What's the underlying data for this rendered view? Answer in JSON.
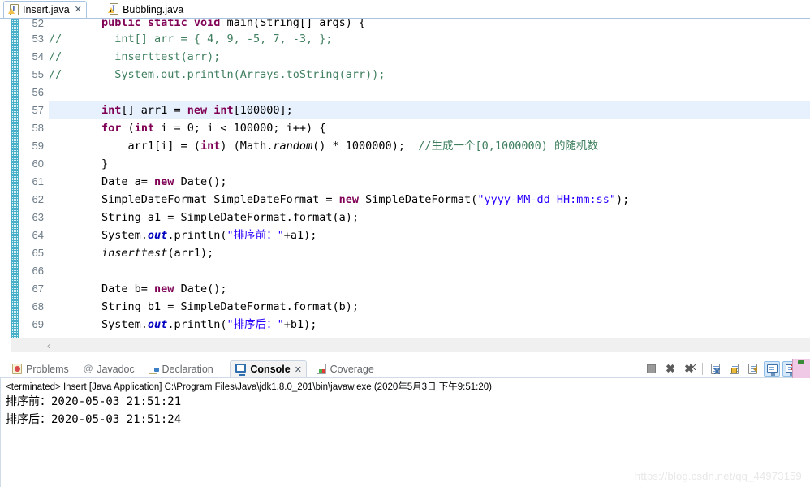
{
  "editor_tabs": [
    {
      "label": "Insert.java",
      "icon": "java-file-icon",
      "active": true,
      "close": "✕"
    },
    {
      "label": "Bubbling.java",
      "icon": "java-file-icon",
      "active": false,
      "close": ""
    }
  ],
  "editor": {
    "highlighted_line": 57,
    "scroll_arrow": "‹",
    "lines": [
      {
        "num": "52",
        "partial": true,
        "tokens": [
          {
            "t": "        ",
            "c": "plain"
          },
          {
            "t": "public static void ",
            "c": "kw"
          },
          {
            "t": "main(String[] args) {",
            "c": "plain"
          }
        ]
      },
      {
        "num": "53",
        "tokens": [
          {
            "t": "//        int[] arr = { 4, 9, -5, 7, -3, };",
            "c": "cmt"
          }
        ]
      },
      {
        "num": "54",
        "tokens": [
          {
            "t": "//        inserttest(arr);",
            "c": "cmt"
          }
        ]
      },
      {
        "num": "55",
        "tokens": [
          {
            "t": "//        System.out.println(Arrays.toString(arr));",
            "c": "cmt"
          }
        ]
      },
      {
        "num": "56",
        "tokens": [
          {
            "t": "",
            "c": "plain"
          }
        ]
      },
      {
        "num": "57",
        "hl": true,
        "tokens": [
          {
            "t": "        ",
            "c": "plain"
          },
          {
            "t": "int",
            "c": "kw"
          },
          {
            "t": "[] arr1 = ",
            "c": "plain"
          },
          {
            "t": "new int",
            "c": "kw"
          },
          {
            "t": "[",
            "c": "plain"
          },
          {
            "t": "100000",
            "c": "num"
          },
          {
            "t": "];",
            "c": "plain"
          }
        ]
      },
      {
        "num": "58",
        "tokens": [
          {
            "t": "        ",
            "c": "plain"
          },
          {
            "t": "for",
            "c": "kw"
          },
          {
            "t": " (",
            "c": "plain"
          },
          {
            "t": "int",
            "c": "kw"
          },
          {
            "t": " i = ",
            "c": "plain"
          },
          {
            "t": "0",
            "c": "num"
          },
          {
            "t": "; i < ",
            "c": "plain"
          },
          {
            "t": "100000",
            "c": "num"
          },
          {
            "t": "; i++) {",
            "c": "plain"
          }
        ]
      },
      {
        "num": "59",
        "tokens": [
          {
            "t": "            arr1[i] = (",
            "c": "plain"
          },
          {
            "t": "int",
            "c": "kw"
          },
          {
            "t": ") (Math.",
            "c": "plain"
          },
          {
            "t": "random",
            "c": "mth"
          },
          {
            "t": "() * ",
            "c": "plain"
          },
          {
            "t": "1000000",
            "c": "num"
          },
          {
            "t": ");  ",
            "c": "plain"
          },
          {
            "t": "//生成一个[0,1000000) 的随机数",
            "c": "cmt"
          }
        ]
      },
      {
        "num": "60",
        "tokens": [
          {
            "t": "        }",
            "c": "plain"
          }
        ]
      },
      {
        "num": "61",
        "tokens": [
          {
            "t": "        Date a= ",
            "c": "plain"
          },
          {
            "t": "new",
            "c": "kw"
          },
          {
            "t": " Date();",
            "c": "plain"
          }
        ]
      },
      {
        "num": "62",
        "tokens": [
          {
            "t": "        SimpleDateFormat SimpleDateFormat = ",
            "c": "plain"
          },
          {
            "t": "new",
            "c": "kw"
          },
          {
            "t": " SimpleDateFormat(",
            "c": "plain"
          },
          {
            "t": "\"yyyy-MM-dd HH:mm:ss\"",
            "c": "str"
          },
          {
            "t": ");",
            "c": "plain"
          }
        ]
      },
      {
        "num": "63",
        "tokens": [
          {
            "t": "        String a1 = SimpleDateFormat.format(a);",
            "c": "plain"
          }
        ]
      },
      {
        "num": "64",
        "tokens": [
          {
            "t": "        System.",
            "c": "plain"
          },
          {
            "t": "out",
            "c": "fld"
          },
          {
            "t": ".println(",
            "c": "plain"
          },
          {
            "t": "\"排序前：\"",
            "c": "str"
          },
          {
            "t": "+a1);",
            "c": "plain"
          }
        ]
      },
      {
        "num": "65",
        "tokens": [
          {
            "t": "        ",
            "c": "plain"
          },
          {
            "t": "inserttest",
            "c": "mth"
          },
          {
            "t": "(arr1);",
            "c": "plain"
          }
        ]
      },
      {
        "num": "66",
        "tokens": [
          {
            "t": "",
            "c": "plain"
          }
        ]
      },
      {
        "num": "67",
        "tokens": [
          {
            "t": "        Date b= ",
            "c": "plain"
          },
          {
            "t": "new",
            "c": "kw"
          },
          {
            "t": " Date();",
            "c": "plain"
          }
        ]
      },
      {
        "num": "68",
        "tokens": [
          {
            "t": "        String b1 = SimpleDateFormat.format(b);",
            "c": "plain"
          }
        ]
      },
      {
        "num": "69",
        "tokens": [
          {
            "t": "        System.",
            "c": "plain"
          },
          {
            "t": "out",
            "c": "fld"
          },
          {
            "t": ".println(",
            "c": "plain"
          },
          {
            "t": "\"排序后：\"",
            "c": "str"
          },
          {
            "t": "+b1);",
            "c": "plain"
          }
        ]
      }
    ]
  },
  "console_tabs": [
    {
      "label": "Problems",
      "icon": "problems-icon",
      "active": false,
      "close": ""
    },
    {
      "label": "Javadoc",
      "icon": "javadoc-icon",
      "active": false,
      "close": ""
    },
    {
      "label": "Declaration",
      "icon": "declaration-icon",
      "active": false,
      "close": ""
    },
    {
      "label": "Console",
      "icon": "console-icon",
      "active": true,
      "close": "✕"
    },
    {
      "label": "Coverage",
      "icon": "coverage-icon",
      "active": false,
      "close": ""
    }
  ],
  "console_toolbar": [
    {
      "name": "terminate-button",
      "glyph": "terminate",
      "on": false
    },
    {
      "name": "remove-launch-button",
      "glyph": "x",
      "on": false
    },
    {
      "name": "remove-all-terminated-button",
      "glyph": "xx",
      "on": false
    },
    {
      "name": "separator-1",
      "glyph": "sep",
      "on": false
    },
    {
      "name": "clear-console-button",
      "glyph": "clear",
      "on": false
    },
    {
      "name": "scroll-lock-button",
      "glyph": "lock",
      "on": false
    },
    {
      "name": "word-wrap-button",
      "glyph": "wrap",
      "on": false
    },
    {
      "name": "pin-console-button",
      "glyph": "monitor",
      "on": true
    },
    {
      "name": "display-selected-console-button",
      "glyph": "monitor-x",
      "on": true
    },
    {
      "name": "separator-2",
      "glyph": "sep",
      "on": false
    }
  ],
  "console_output": {
    "header": "<terminated> Insert [Java Application] C:\\Program Files\\Java\\jdk1.8.0_201\\bin\\javaw.exe (2020年5月3日 下午9:51:20)",
    "lines": [
      "排序前：2020-05-03 21:51:21",
      "排序后：2020-05-03 21:51:24"
    ]
  },
  "watermark": "https://blog.csdn.net/qq_44973159",
  "colors": {
    "keyword": "#7f0055",
    "comment": "#3f7f5f",
    "string": "#2a00ff",
    "field": "#0000c0",
    "highlight_line": "#e7f0fd",
    "change_bar": "#27a3bf",
    "tab_border": "#a8c4e0"
  }
}
